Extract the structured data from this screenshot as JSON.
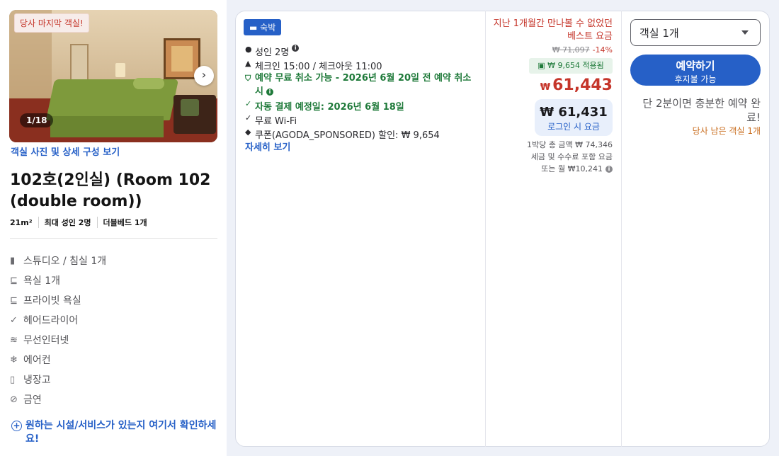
{
  "room": {
    "last_room_badge": "당사 마지막 객실!",
    "photo_count": "1/18",
    "photo_link": "객실 사진 및 상세 구성 보기",
    "title": "102호(2인실) (Room 102 (double room))",
    "meta": [
      "21m²",
      "최대 성인 2명",
      "더블베드 1개"
    ],
    "amenities": [
      {
        "icon": "studio-icon",
        "label": "스튜디오 / 침실 1개"
      },
      {
        "icon": "bath-icon",
        "label": "욕실 1개"
      },
      {
        "icon": "bath-icon",
        "label": "프라이빗 욕실"
      },
      {
        "icon": "check-icon",
        "label": "헤어드라이어"
      },
      {
        "icon": "wifi-icon",
        "label": "무선인터넷"
      },
      {
        "icon": "snowflake-icon",
        "label": "에어컨"
      },
      {
        "icon": "fridge-icon",
        "label": "냉장고"
      },
      {
        "icon": "no-smoking-icon",
        "label": "금연"
      }
    ],
    "ask_text": "원하는 시설/서비스가 있는지 여기서 확인하세요!"
  },
  "offer": {
    "stay_pill": "숙박",
    "features": {
      "adults": "성인 2명",
      "checkin": "체크인 15:00 / 체크아웃 11:00",
      "free_cancel": "예약 무료 취소 가능 - 2026년 6월 20일 전 예약 취소 시",
      "auto_pay": "자동 결제 예정일: 2026년 6월 18일",
      "wifi": "무료 Wi-Fi",
      "coupon": "쿠폰(AGODA_SPONSORED) 할인: ₩ 9,654"
    },
    "more_link": "자세히 보기"
  },
  "price": {
    "best_label": "지난 1개월간 만나볼 수 없었던 베스트 요금",
    "old_price": "₩ 71,097",
    "discount_pct": "-14%",
    "coupon_badge": "₩ 9,654 적용됨",
    "currency": "₩",
    "current": "61,443",
    "login_price": "₩ 61,431",
    "login_label": "로그인 시 요금",
    "notes": [
      "1박당 총 금액 ₩ 74,346",
      "세금 및 수수료 포함 요금",
      "또는 월 ₩10,241"
    ]
  },
  "action": {
    "room_select": "객실 1개",
    "book_label": "예약하기",
    "book_sub": "후지불 가능",
    "urgency": "단 2분이면 충분한 예약 완료!",
    "rooms_left": "당사 남은 객실 1개"
  },
  "colors": {
    "primary": "#2660c7",
    "sale_red": "#c5352a",
    "green": "#1f7a3a",
    "orange": "#c96d1e"
  }
}
